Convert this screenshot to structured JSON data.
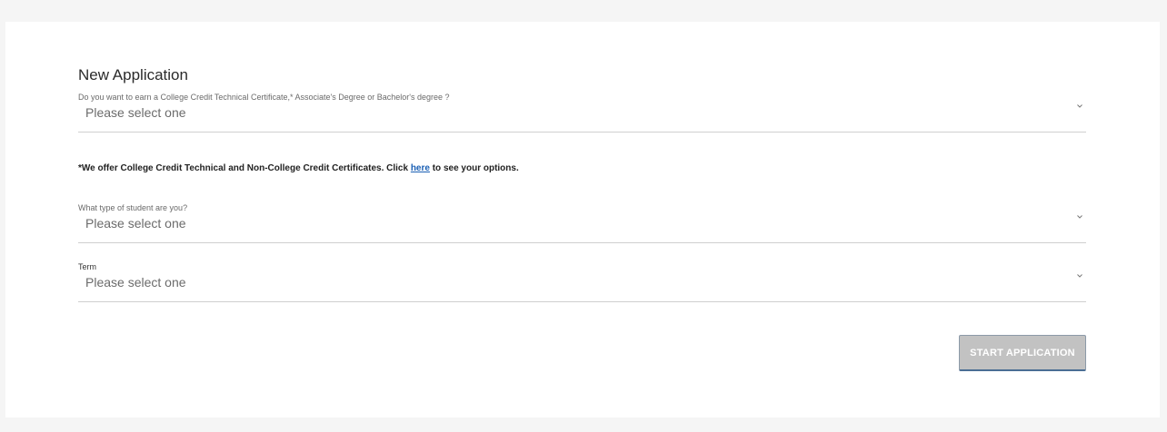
{
  "form": {
    "title": "New Application",
    "fields": [
      {
        "label": "Do you want to earn a College Credit Technical Certificate,* Associate's Degree or Bachelor's degree ?",
        "value": "Please select one",
        "icon": "chevron-down-icon"
      },
      {
        "label": "What type of student are you?",
        "value": "Please select one",
        "icon": "chevron-down-icon"
      },
      {
        "label": "Term",
        "value": "Please select one",
        "icon": "chevron-down-icon"
      }
    ],
    "note": {
      "before": "*We offer College Credit Technical and Non-College Credit Certificates. Click ",
      "link": "here",
      "after": " to see your options."
    },
    "start_button": "START APPLICATION"
  },
  "colors": {
    "page_background": "#f5f5f5",
    "card_background": "#ffffff",
    "button_background": "#c2c2c2",
    "button_border": "#4a6e94",
    "link": "#1a5fb4"
  }
}
